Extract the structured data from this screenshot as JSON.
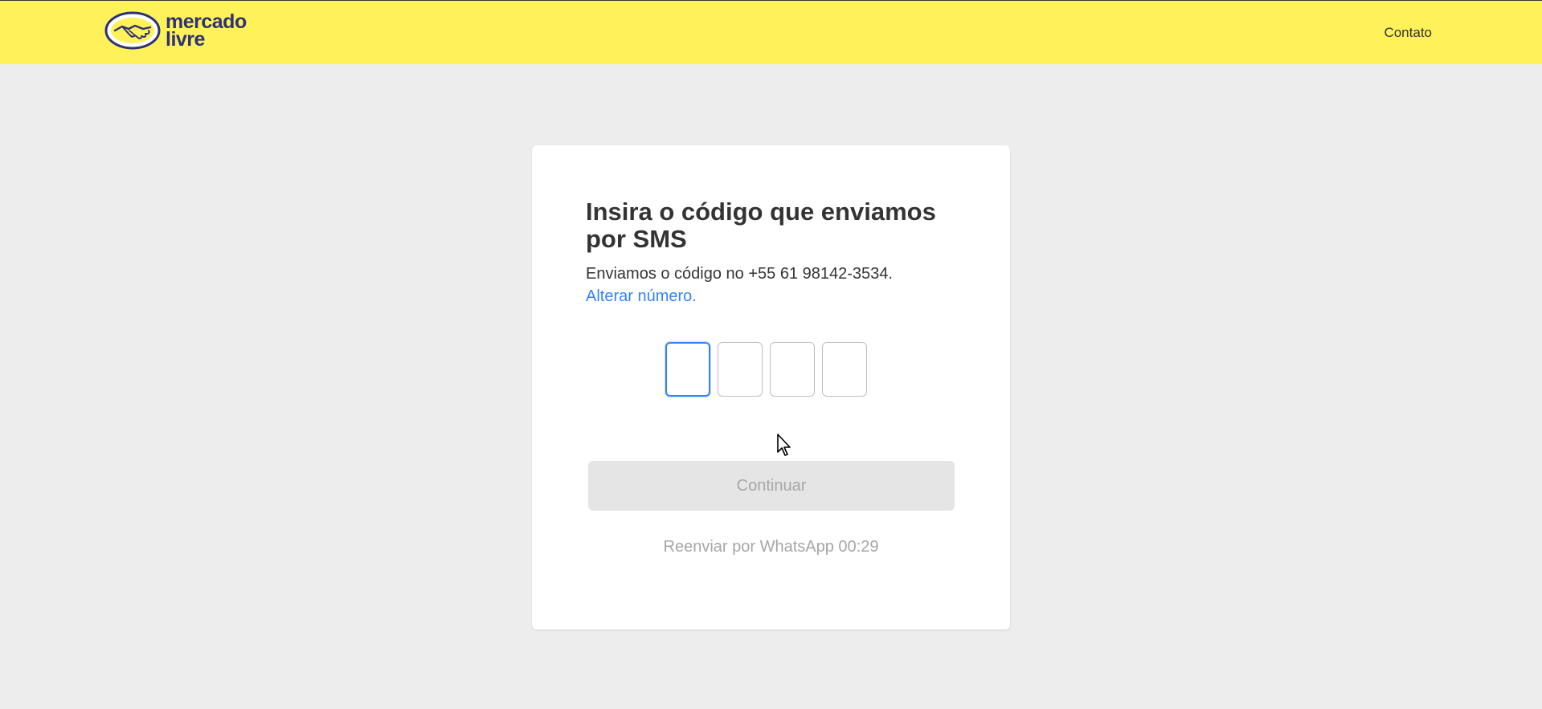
{
  "header": {
    "logo_line1": "mercado",
    "logo_line2": "livre",
    "contact_label": "Contato"
  },
  "verification": {
    "title": "Insira o código que enviamos por SMS",
    "sent_text": "Enviamos o código no +55 61 98142-3534.",
    "change_number_label": "Alterar número.",
    "code_digits": [
      "",
      "",
      "",
      ""
    ],
    "continue_label": "Continuar",
    "resend_text": "Reenviar por WhatsApp 00:29"
  },
  "colors": {
    "header_bg": "#fff159",
    "page_bg": "#ededed",
    "link": "#3483fa",
    "brand_text": "#2d3277",
    "disabled_text": "#a6a6a6"
  },
  "icons": {
    "logo": "handshake-logo-icon",
    "cursor": "mouse-pointer-icon"
  }
}
